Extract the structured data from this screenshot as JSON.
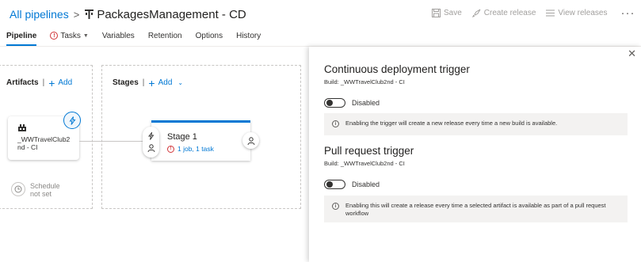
{
  "header": {
    "breadcrumb_root": "All pipelines",
    "pipeline_name": "PackagesManagement - CD",
    "toolbar": {
      "save_label": "Save",
      "create_release_label": "Create release",
      "view_releases_label": "View releases",
      "more_label": "···"
    }
  },
  "tabs": [
    {
      "label": "Pipeline",
      "active": true
    },
    {
      "label": "Tasks",
      "warning": true
    },
    {
      "label": "Variables"
    },
    {
      "label": "Retention"
    },
    {
      "label": "Options"
    },
    {
      "label": "History"
    }
  ],
  "artifacts": {
    "title": "Artifacts",
    "add_label": "Add",
    "card": {
      "name": "_WWTravelClub2nd - CI"
    },
    "schedule": {
      "line1": "Schedule",
      "line2": "not set"
    }
  },
  "stages": {
    "title": "Stages",
    "add_label": "Add",
    "card": {
      "title": "Stage 1",
      "subtitle": "1 job, 1 task"
    }
  },
  "panel": {
    "close_label": "✕",
    "cd": {
      "title": "Continuous deployment trigger",
      "build": "Build: _WWTravelClub2nd - CI",
      "toggle_label": "Disabled",
      "info": "Enabling the trigger will create a new release every time a new build is available."
    },
    "pr": {
      "title": "Pull request trigger",
      "build": "Build: _WWTravelClub2nd - CI",
      "toggle_label": "Disabled",
      "info": "Enabling this will create a release every time a selected artifact is available as part of a pull request workflow"
    }
  },
  "colors": {
    "accent": "#0078d4",
    "warning": "#d13438"
  }
}
